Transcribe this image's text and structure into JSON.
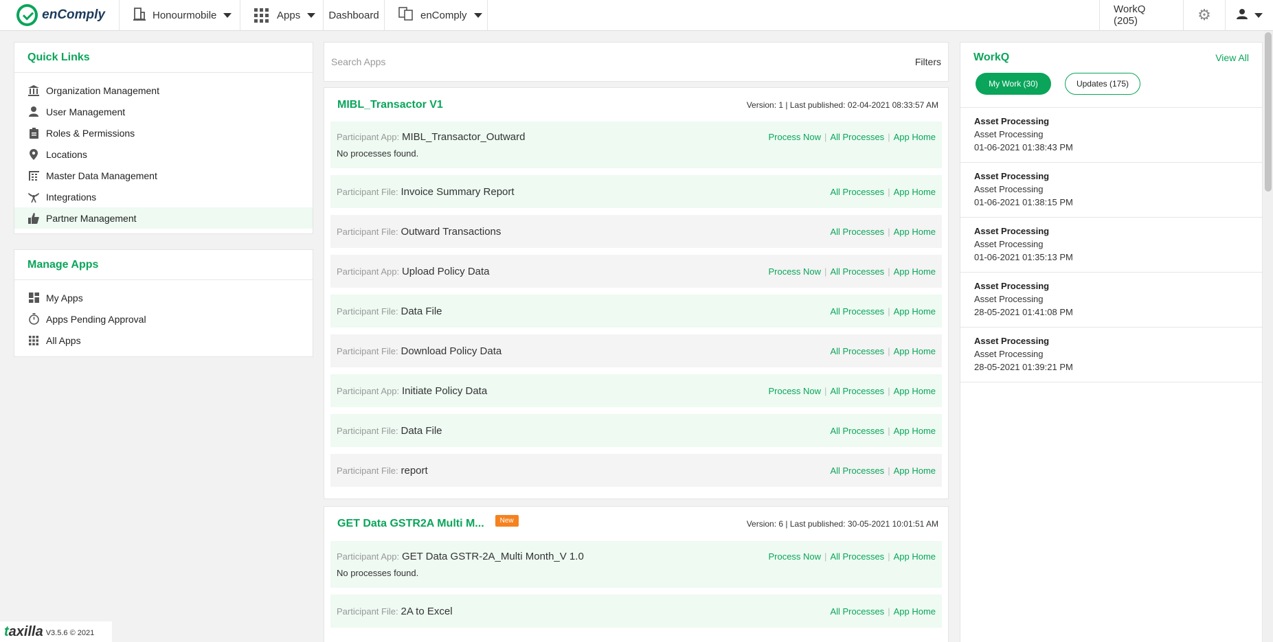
{
  "header": {
    "logo_text": "enComply",
    "org_name": "Honourmobile",
    "apps_label": "Apps",
    "dashboard_label": "Dashboard",
    "product_label": "enComply",
    "workq_label": "WorkQ (205)"
  },
  "search": {
    "placeholder": "Search Apps",
    "filters_label": "Filters"
  },
  "quick_links": {
    "title": "Quick Links",
    "items": [
      {
        "label": "Organization Management"
      },
      {
        "label": "User Management"
      },
      {
        "label": "Roles & Permissions"
      },
      {
        "label": "Locations"
      },
      {
        "label": "Master Data Management"
      },
      {
        "label": "Integrations"
      },
      {
        "label": "Partner Management"
      }
    ]
  },
  "manage_apps": {
    "title": "Manage Apps",
    "items": [
      {
        "label": "My Apps"
      },
      {
        "label": "Apps Pending Approval"
      },
      {
        "label": "All Apps"
      }
    ]
  },
  "link_labels": {
    "process_now": "Process Now",
    "all_processes": "All Processes",
    "app_home": "App Home",
    "sep": "|",
    "no_processes": "No processes found."
  },
  "apps": [
    {
      "name": "MIBL_Transactor V1",
      "meta": "Version: 1 | Last published: 02-04-2021 08:33:57 AM",
      "rows": [
        {
          "label": "Participant App:",
          "value": "MIBL_Transactor_Outward"
        },
        {
          "label": "Participant File:",
          "value": "Invoice Summary Report"
        },
        {
          "label": "Participant File:",
          "value": "Outward Transactions"
        },
        {
          "label": "Participant App:",
          "value": "Upload Policy Data"
        },
        {
          "label": "Participant File:",
          "value": "Data File"
        },
        {
          "label": "Participant File:",
          "value": "Download Policy Data"
        },
        {
          "label": "Participant App:",
          "value": "Initiate Policy Data"
        },
        {
          "label": "Participant File:",
          "value": "Data File"
        },
        {
          "label": "Participant File:",
          "value": "report"
        }
      ]
    },
    {
      "name": "GET Data GSTR2A Multi M...",
      "badge": "New",
      "meta": "Version: 6 | Last published: 30-05-2021 10:01:51 AM",
      "rows": [
        {
          "label": "Participant App:",
          "value": "GET Data GSTR-2A_Multi Month_V 1.0"
        },
        {
          "label": "Participant File:",
          "value": "2A to Excel"
        }
      ]
    }
  ],
  "workq": {
    "title": "WorkQ",
    "view_all": "View All",
    "tab_my_work": "My Work (30)",
    "tab_updates": "Updates (175)",
    "items": [
      {
        "title": "Asset Processing",
        "subtitle": "Asset Processing",
        "time": "01-06-2021 01:38:43 PM"
      },
      {
        "title": "Asset Processing",
        "subtitle": "Asset Processing",
        "time": "01-06-2021 01:38:15 PM"
      },
      {
        "title": "Asset Processing",
        "subtitle": "Asset Processing",
        "time": "01-06-2021 01:35:13 PM"
      },
      {
        "title": "Asset Processing",
        "subtitle": "Asset Processing",
        "time": "28-05-2021 01:41:08 PM"
      },
      {
        "title": "Asset Processing",
        "subtitle": "Asset Processing",
        "time": "28-05-2021 01:39:21 PM"
      }
    ]
  },
  "footer": {
    "brand_t": "t",
    "brand_rest": "axilla",
    "version": "V3.5.6 © 2021"
  }
}
